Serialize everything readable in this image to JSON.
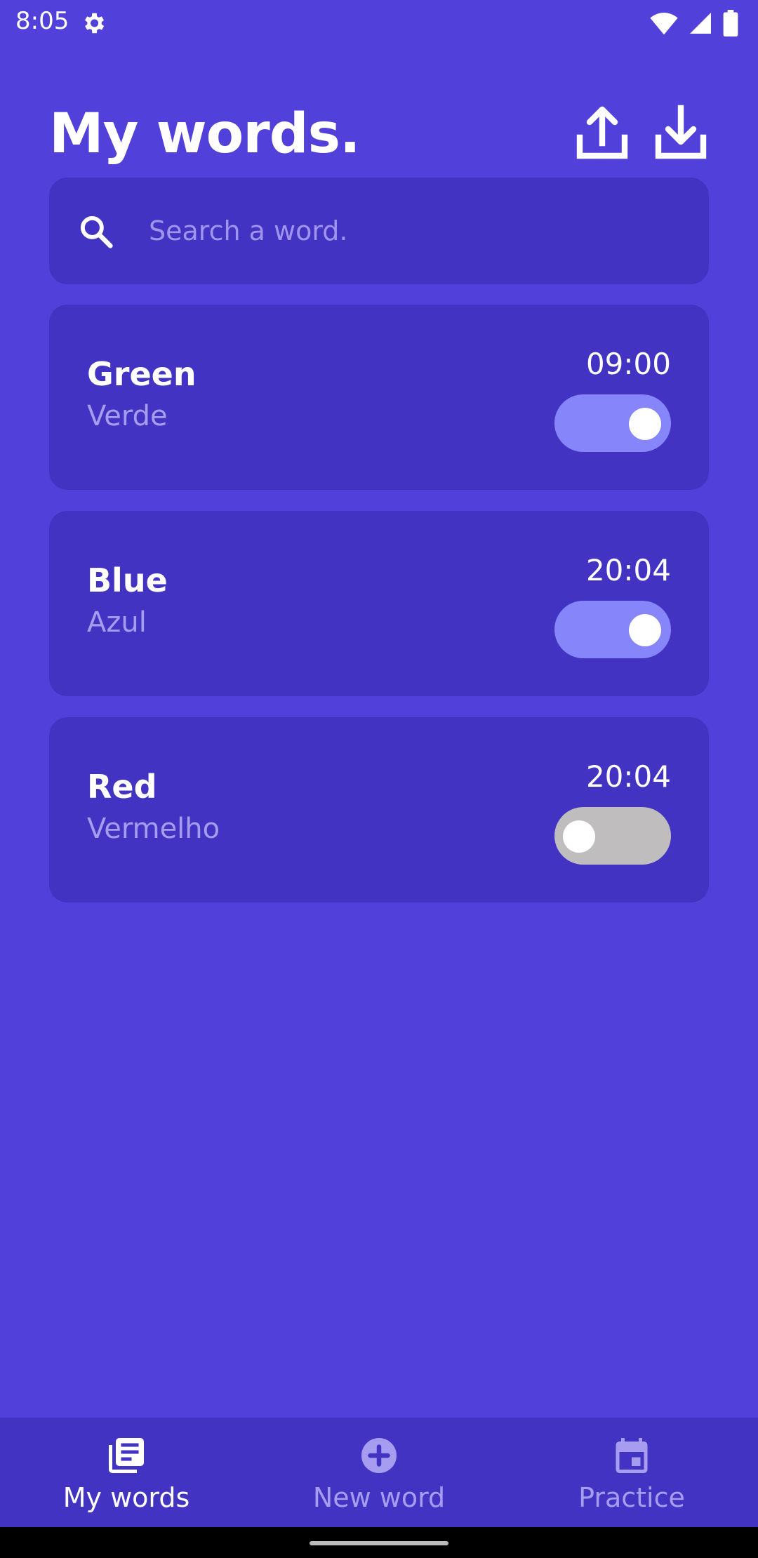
{
  "status_bar": {
    "time": "8:05",
    "icons": [
      "gear-icon",
      "wifi-icon",
      "signal-icon",
      "battery-icon"
    ]
  },
  "header": {
    "title": "My words.",
    "actions": [
      "upload-icon",
      "download-icon"
    ]
  },
  "search": {
    "placeholder": "Search a word.",
    "value": ""
  },
  "words": [
    {
      "word": "Green",
      "translation": "Verde",
      "time": "09:00",
      "enabled": true
    },
    {
      "word": "Blue",
      "translation": "Azul",
      "time": "20:04",
      "enabled": true
    },
    {
      "word": "Red",
      "translation": "Vermelho",
      "time": "20:04",
      "enabled": false
    }
  ],
  "bottom_nav": {
    "items": [
      {
        "label": "My words",
        "icon": "library-icon",
        "active": true
      },
      {
        "label": "New word",
        "icon": "add-circle-icon",
        "active": false
      },
      {
        "label": "Practice",
        "icon": "calendar-icon",
        "active": false
      }
    ]
  },
  "colors": {
    "background": "#5140d9",
    "card": "#4233c2",
    "toggle_on": "#8785fa",
    "toggle_off": "#bfbdbd",
    "muted_text": "#a79df0"
  }
}
